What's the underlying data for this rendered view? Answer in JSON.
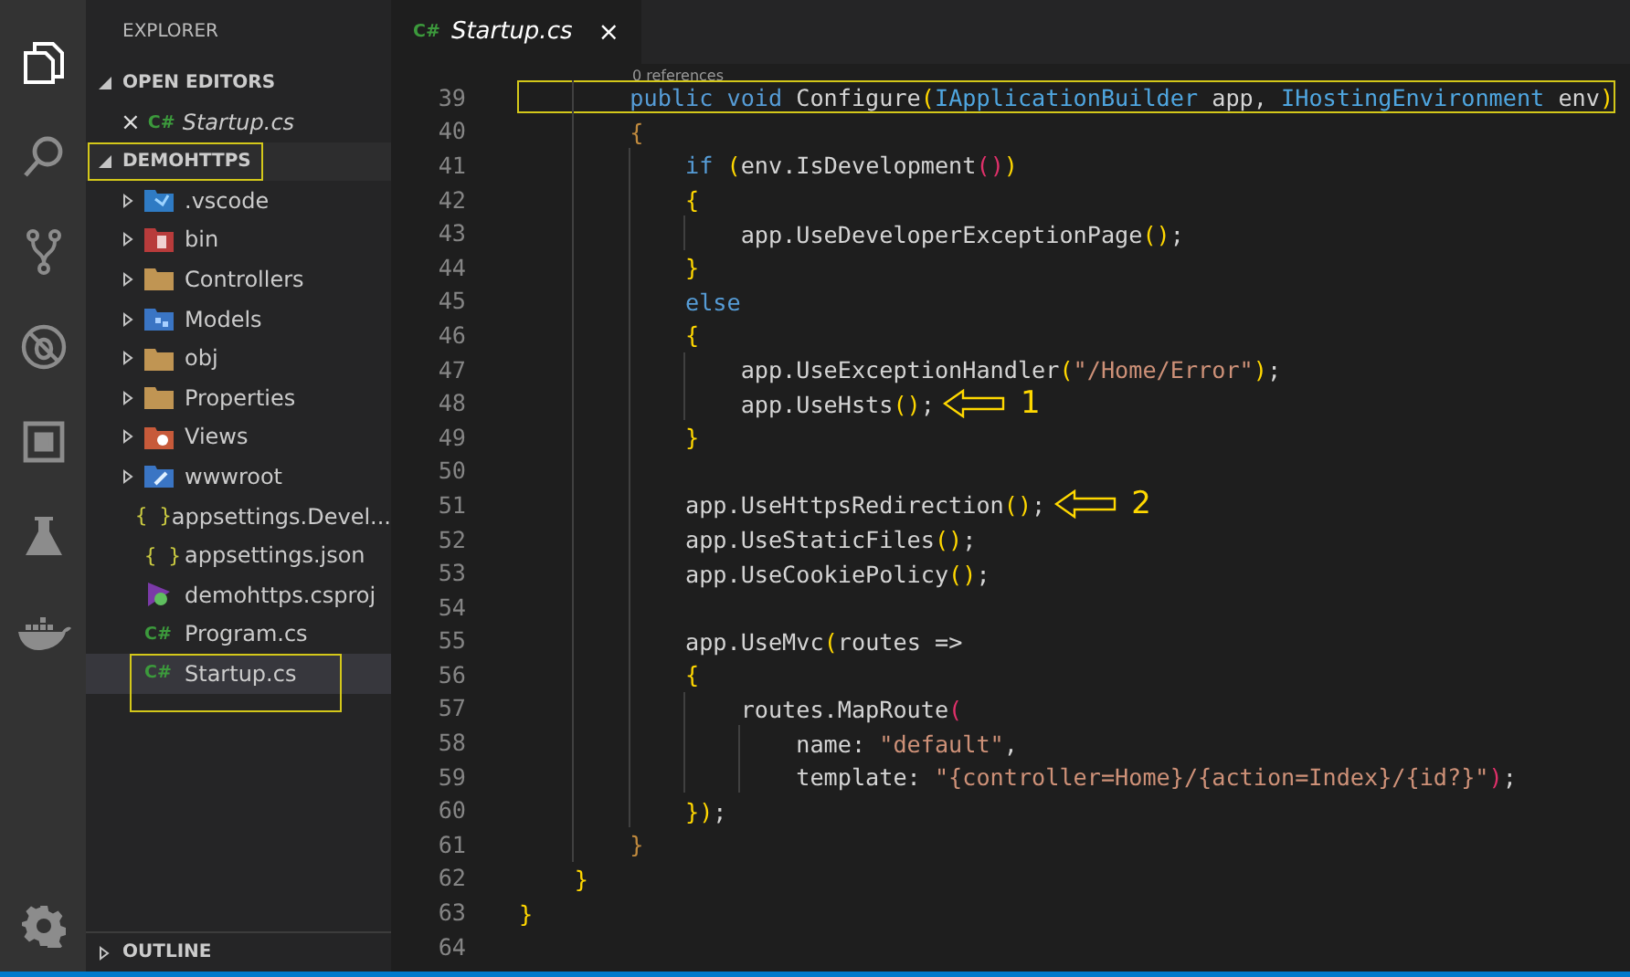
{
  "activity_bar": [
    {
      "kind": "files",
      "selected": true
    },
    {
      "kind": "search",
      "selected": false
    },
    {
      "kind": "source-control",
      "selected": false
    },
    {
      "kind": "debug",
      "selected": false
    },
    {
      "kind": "extensions",
      "selected": false
    },
    {
      "kind": "flask",
      "selected": false
    },
    {
      "kind": "docker",
      "selected": false
    }
  ],
  "settings_icon": {
    "kind": "gear"
  },
  "sidebar": {
    "title": "EXPLORER",
    "open_editors": {
      "label": "OPEN EDITORS",
      "expanded": true,
      "items": [
        {
          "close": "×",
          "icon_text": "C#",
          "label": "Startup.cs"
        }
      ]
    },
    "project": {
      "label": "DEMOHTTPS",
      "expanded": true,
      "highlighted": true,
      "items": [
        {
          "label": ".vscode",
          "kind": "vscode",
          "expandable": true,
          "selected": false,
          "highlighted": false
        },
        {
          "label": "bin",
          "kind": "bin",
          "expandable": true,
          "selected": false,
          "highlighted": false
        },
        {
          "label": "Controllers",
          "kind": "folder",
          "expandable": true,
          "selected": false,
          "highlighted": false
        },
        {
          "label": "Models",
          "kind": "models",
          "expandable": true,
          "selected": false,
          "highlighted": false
        },
        {
          "label": "obj",
          "kind": "folder",
          "expandable": true,
          "selected": false,
          "highlighted": false
        },
        {
          "label": "Properties",
          "kind": "folder",
          "expandable": true,
          "selected": false,
          "highlighted": false
        },
        {
          "label": "Views",
          "kind": "views",
          "expandable": true,
          "selected": false,
          "highlighted": false
        },
        {
          "label": "wwwroot",
          "kind": "wwwroot",
          "expandable": true,
          "selected": false,
          "highlighted": false
        },
        {
          "label": "appsettings.Devel...",
          "kind": "json",
          "icon_text": "{ }",
          "expandable": false,
          "selected": false,
          "highlighted": false
        },
        {
          "label": "appsettings.json",
          "kind": "json",
          "icon_text": "{ }",
          "expandable": false,
          "selected": false,
          "highlighted": false
        },
        {
          "label": "demohttps.csproj",
          "kind": "csproj",
          "expandable": false,
          "selected": false,
          "highlighted": false
        },
        {
          "label": "Program.cs",
          "kind": "csharp",
          "icon_text": "C#",
          "expandable": false,
          "selected": false,
          "highlighted": false
        },
        {
          "label": "Startup.cs",
          "kind": "csharp",
          "icon_text": "C#",
          "expandable": false,
          "selected": true,
          "highlighted": true
        }
      ]
    },
    "outline": {
      "label": "OUTLINE",
      "expanded": false
    }
  },
  "tabs": [
    {
      "icon_text": "C#",
      "label": "Startup.cs",
      "close": "×",
      "selected": true
    }
  ],
  "editor": {
    "codelens": "0 references",
    "lines": [
      {
        "number": "39",
        "highlighted": true,
        "tokens": [
          {
            "kind": "kw",
            "text": "        public void"
          },
          {
            "kind": "plain",
            "text": " Configure"
          },
          {
            "kind": "b1",
            "text": "("
          },
          {
            "kind": "type",
            "text": "IApplicationBuilder"
          },
          {
            "kind": "plain",
            "text": " app, "
          },
          {
            "kind": "type",
            "text": "IHostingEnvironment"
          },
          {
            "kind": "plain",
            "text": " env"
          },
          {
            "kind": "b1",
            "text": ")"
          }
        ]
      },
      {
        "number": "40",
        "highlighted": false,
        "tokens": [
          {
            "kind": "b3",
            "text": "        {"
          }
        ]
      },
      {
        "number": "41",
        "highlighted": false,
        "tokens": [
          {
            "kind": "kw",
            "text": "            if"
          },
          {
            "kind": "b1",
            "text": " ("
          },
          {
            "kind": "plain",
            "text": "env.IsDevelopment"
          },
          {
            "kind": "b2",
            "text": "()"
          },
          {
            "kind": "b1",
            "text": ")"
          }
        ]
      },
      {
        "number": "42",
        "highlighted": false,
        "tokens": [
          {
            "kind": "b1",
            "text": "            {"
          }
        ]
      },
      {
        "number": "43",
        "highlighted": false,
        "tokens": [
          {
            "kind": "plain",
            "text": "                app.UseDeveloperExceptionPage"
          },
          {
            "kind": "b1",
            "text": "()"
          },
          {
            "kind": "plain",
            "text": ";"
          }
        ]
      },
      {
        "number": "44",
        "highlighted": false,
        "tokens": [
          {
            "kind": "b1",
            "text": "            }"
          }
        ]
      },
      {
        "number": "45",
        "highlighted": false,
        "tokens": [
          {
            "kind": "kw",
            "text": "            else"
          }
        ]
      },
      {
        "number": "46",
        "highlighted": false,
        "tokens": [
          {
            "kind": "b1",
            "text": "            {"
          }
        ]
      },
      {
        "number": "47",
        "highlighted": false,
        "tokens": [
          {
            "kind": "plain",
            "text": "                app.UseExceptionHandler"
          },
          {
            "kind": "b1",
            "text": "("
          },
          {
            "kind": "str",
            "text": "\"/Home/Error\""
          },
          {
            "kind": "b1",
            "text": ")"
          },
          {
            "kind": "plain",
            "text": ";"
          }
        ]
      },
      {
        "number": "48",
        "highlighted": false,
        "tokens": [
          {
            "kind": "plain",
            "text": "                app.UseHsts"
          },
          {
            "kind": "b1",
            "text": "()"
          },
          {
            "kind": "plain",
            "text": ";"
          }
        ],
        "annotation": {
          "label": "1"
        }
      },
      {
        "number": "49",
        "highlighted": false,
        "tokens": [
          {
            "kind": "b1",
            "text": "            }"
          }
        ]
      },
      {
        "number": "50",
        "highlighted": false
      },
      {
        "number": "51",
        "highlighted": false,
        "tokens": [
          {
            "kind": "plain",
            "text": "            app.UseHttpsRedirection"
          },
          {
            "kind": "b1",
            "text": "()"
          },
          {
            "kind": "plain",
            "text": ";"
          }
        ],
        "annotation": {
          "label": "2"
        }
      },
      {
        "number": "52",
        "highlighted": false,
        "tokens": [
          {
            "kind": "plain",
            "text": "            app.UseStaticFiles"
          },
          {
            "kind": "b1",
            "text": "()"
          },
          {
            "kind": "plain",
            "text": ";"
          }
        ]
      },
      {
        "number": "53",
        "highlighted": false,
        "tokens": [
          {
            "kind": "plain",
            "text": "            app.UseCookiePolicy"
          },
          {
            "kind": "b1",
            "text": "()"
          },
          {
            "kind": "plain",
            "text": ";"
          }
        ]
      },
      {
        "number": "54",
        "highlighted": false
      },
      {
        "number": "55",
        "highlighted": false,
        "tokens": [
          {
            "kind": "plain",
            "text": "            app.UseMvc"
          },
          {
            "kind": "b1",
            "text": "("
          },
          {
            "kind": "plain",
            "text": "routes =>"
          }
        ]
      },
      {
        "number": "56",
        "highlighted": false,
        "tokens": [
          {
            "kind": "b1",
            "text": "            {"
          }
        ]
      },
      {
        "number": "57",
        "highlighted": false,
        "tokens": [
          {
            "kind": "plain",
            "text": "                routes.MapRoute"
          },
          {
            "kind": "b2",
            "text": "("
          }
        ]
      },
      {
        "number": "58",
        "highlighted": false,
        "tokens": [
          {
            "kind": "plain",
            "text": "                    name: "
          },
          {
            "kind": "str",
            "text": "\"default\""
          },
          {
            "kind": "plain",
            "text": ","
          }
        ]
      },
      {
        "number": "59",
        "highlighted": false,
        "tokens": [
          {
            "kind": "plain",
            "text": "                    template: "
          },
          {
            "kind": "str",
            "text": "\"{controller=Home}/{action=Index}/{id?}\""
          },
          {
            "kind": "b2",
            "text": ")"
          },
          {
            "kind": "plain",
            "text": ";"
          }
        ]
      },
      {
        "number": "60",
        "highlighted": false,
        "tokens": [
          {
            "kind": "b1",
            "text": "            })"
          },
          {
            "kind": "plain",
            "text": ";"
          }
        ]
      },
      {
        "number": "61",
        "highlighted": false,
        "tokens": [
          {
            "kind": "b3",
            "text": "        }"
          }
        ]
      },
      {
        "number": "62",
        "highlighted": false,
        "tokens": [
          {
            "kind": "b1",
            "text": "    }"
          }
        ]
      },
      {
        "number": "63",
        "highlighted": false,
        "tokens": [
          {
            "kind": "b1",
            "text": "}"
          }
        ]
      },
      {
        "number": "64",
        "highlighted": false
      }
    ]
  }
}
